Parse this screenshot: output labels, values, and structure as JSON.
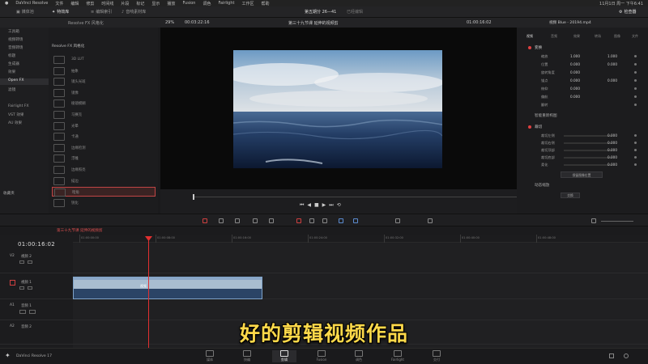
{
  "menubar": {
    "items": [
      "DaVinci Resolve",
      "文件",
      "编辑",
      "修剪",
      "时间线",
      "片段",
      "标记",
      "显示",
      "播放",
      "Fusion",
      "调色",
      "Fairlight",
      "工作区",
      "帮助"
    ],
    "clock": "11月1日 周一 下午6:41"
  },
  "titlebar": {
    "tabs": [
      {
        "label": "媒体池",
        "active": false
      },
      {
        "label": "特效库",
        "active": true
      },
      {
        "label": "编辑索引",
        "active": false
      },
      {
        "label": "音响素材库",
        "active": false
      }
    ],
    "project": "第五期分 26—41",
    "project_sub": "已经编辑"
  },
  "viewer_bar": {
    "zoom": "29%",
    "timecode_left": "00:03:22:16",
    "timeline_name": "第三十九节课 延伸的视频剪",
    "timecode_right": "01:00:16:02"
  },
  "left_panel": {
    "items": [
      "工具箱",
      "视频转场",
      "音频转场",
      "标题",
      "生成器",
      "效果",
      "Open FX",
      "滤镜",
      "Fairlight FX",
      "VST 效果",
      "AU 效果"
    ],
    "selected": "Open FX",
    "footer": "收藏夹"
  },
  "fx_panel": {
    "header": "Resolve FX 风格化",
    "items": [
      "3D LUT",
      "抽象",
      "镜头光斑",
      "镜像",
      "棱镜模糊",
      "马赛克",
      "光晕",
      "卡通",
      "边缘检测",
      "浮雕",
      "边缘照亮",
      "描边",
      "暗角",
      "锐化"
    ],
    "selected_index": 12
  },
  "inspector": {
    "title": "检查器",
    "clip": "视频 Blue - 20194.mp4",
    "tabs": [
      "视频",
      "音频",
      "效果",
      "转场",
      "图像",
      "文件"
    ],
    "section_transform": "变换",
    "rows": [
      {
        "label": "缩放",
        "x": "1.000",
        "y": "1.000"
      },
      {
        "label": "位置",
        "x": "0.000",
        "y": "0.000"
      },
      {
        "label": "旋转角度",
        "x": "0.000",
        "y": ""
      },
      {
        "label": "锚点",
        "x": "0.000",
        "y": "0.000"
      },
      {
        "label": "俯仰",
        "x": "0.000",
        "y": ""
      },
      {
        "label": "偏航",
        "x": "0.000",
        "y": ""
      },
      {
        "label": "翻转",
        "x": "",
        "y": ""
      }
    ],
    "section_smart": "智能重新构图",
    "section_crop": "裁切",
    "crop_rows": [
      {
        "label": "裁切左侧",
        "val": "0.000"
      },
      {
        "label": "裁切右侧",
        "val": "0.000"
      },
      {
        "label": "裁切顶部",
        "val": "0.000"
      },
      {
        "label": "裁切底部",
        "val": "0.000"
      },
      {
        "label": "柔化",
        "val": "0.000"
      }
    ],
    "crop_button": "保留图像位置",
    "section_dynamic": "动态缩放",
    "dynamic_button": "交换"
  },
  "timeline": {
    "tab_label": "第三十九节课 延伸的视频剪",
    "timecode": "01:00:16:02",
    "ruler_labels": [
      "01:00:00:00",
      "01:00:08:00",
      "01:00:16:00",
      "01:00:24:00",
      "01:00:32:00",
      "01:00:40:00",
      "01:00:48:00"
    ],
    "tracks": [
      {
        "id": "V2",
        "name": "视频 2"
      },
      {
        "id": "V1",
        "name": "视频 1"
      },
      {
        "id": "A1",
        "name": "音频 1"
      },
      {
        "id": "A2",
        "name": "音频 2"
      }
    ],
    "clip_label": "视频"
  },
  "subtitle": "好的剪辑视频作品",
  "bottom_bar": {
    "app": "DaVinci Resolve 17",
    "pages": [
      "媒体",
      "快编",
      "剪辑",
      "Fusion",
      "调色",
      "Fairlight",
      "交付"
    ],
    "active_page": "剪辑"
  },
  "colors": {
    "accent_red": "#e23030",
    "clip_blue": "#7fa3c8",
    "subtitle_yellow": "#ffd94a"
  }
}
